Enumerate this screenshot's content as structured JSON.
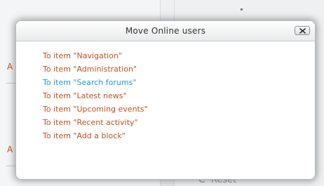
{
  "background": {
    "left_letters": [
      "A",
      "A"
    ],
    "reset_icon": "refresh-icon",
    "reset_label": "Reset"
  },
  "dialog": {
    "title": "Move Online users",
    "close_icon": "close-icon",
    "items": [
      {
        "label": "To item \"Navigation\"",
        "hovered": false
      },
      {
        "label": "To item \"Administration\"",
        "hovered": false
      },
      {
        "label": "To item \"Search forums\"",
        "hovered": true
      },
      {
        "label": "To item \"Latest news\"",
        "hovered": false
      },
      {
        "label": "To item \"Upcoming events\"",
        "hovered": false
      },
      {
        "label": "To item \"Recent activity\"",
        "hovered": false
      },
      {
        "label": "To item \"Add a block\"",
        "hovered": false
      }
    ]
  },
  "colors": {
    "link": "#c0521e",
    "link_hover": "#1f9bd6"
  }
}
